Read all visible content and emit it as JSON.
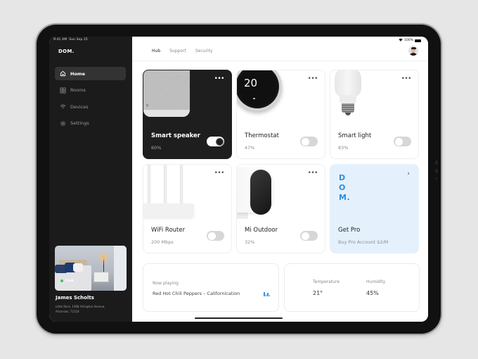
{
  "status_bar": {
    "time": "9:41 AM",
    "date": "Sun Sep 25",
    "battery": "100%"
  },
  "sidebar": {
    "logo": "DOM.",
    "items": [
      {
        "label": "Home",
        "icon": "home-icon",
        "active": true
      },
      {
        "label": "Rooms",
        "icon": "grid-icon",
        "active": false
      },
      {
        "label": "Devices",
        "icon": "wifi-icon",
        "active": false
      },
      {
        "label": "Settings",
        "icon": "gear-icon",
        "active": false
      }
    ],
    "live": {
      "label": "Live",
      "status_color": "#3ec45a"
    },
    "user": {
      "name": "James Scholts",
      "address": "Little Rock, 1468 Arlington Avenue, Arkansas, 72118"
    }
  },
  "header": {
    "tabs": [
      {
        "label": "Hub",
        "active": true
      },
      {
        "label": "Support",
        "active": false
      },
      {
        "label": "Security",
        "active": false
      }
    ],
    "more_icon": "•••"
  },
  "devices": [
    {
      "name": "Smart speaker",
      "value": "60%",
      "on": true,
      "theme": "dark"
    },
    {
      "name": "Thermostat",
      "value": "47%",
      "on": false,
      "display": "20"
    },
    {
      "name": "Smart light",
      "value": "83%",
      "on": false
    },
    {
      "name": "WiFi Router",
      "value": "200 Mbps",
      "on": false
    },
    {
      "name": "Mi Outdoor",
      "value": "32%",
      "on": false
    }
  ],
  "promo": {
    "logo_lines": [
      "D",
      "O",
      "M."
    ],
    "title": "Get Pro",
    "subtitle": "Buy Pro Account $2/M",
    "accent": "#2a8ee0",
    "chevron": "›"
  },
  "now_playing": {
    "label": "Now playing",
    "track": "Red Hot Chili Peppers – Californication"
  },
  "climate": {
    "temperature": {
      "label": "Temperature",
      "value": "21°"
    },
    "humidity": {
      "label": "Humidity",
      "value": "45%"
    }
  }
}
